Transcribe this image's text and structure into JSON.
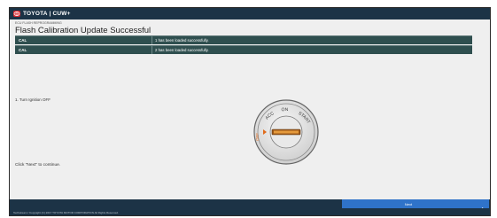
{
  "header": {
    "brand": "TOYOTA | CUW+"
  },
  "breadcrumb": "ECU FLASH REPROGRAMMING",
  "page_title": "Flash Calibration Update Successful",
  "results": [
    {
      "ecu": "CAL",
      "status": "1 has been loaded successfully."
    },
    {
      "ecu": "CAL",
      "status": "2 has been loaded successfully."
    }
  ],
  "instructions": {
    "step": "1. Turn Ignition OFF",
    "continue": "Click \"Next\" to continue."
  },
  "ignition_dial": {
    "labels": {
      "lock": "LOCK",
      "acc": "ACC",
      "on": "ON",
      "start": "START",
      "off": "OFF"
    },
    "selected_position": "OFF"
  },
  "footer": {
    "next_label": "Next",
    "copyright": "Techstream / Copyright (C) 2017 TOYOTA MOTOR CORPORATION All Rights Reserved."
  },
  "colors": {
    "header_bg": "#1c3346",
    "row_bg": "#2f4f4f",
    "next_button": "#2f73c9",
    "brand_red": "#d8262e",
    "off_marker": "#e06a1a"
  },
  "icons": [
    "toyota-logo-icon",
    "ignition-key-icon",
    "next-arrow-icon",
    "resize-grip-icon"
  ]
}
